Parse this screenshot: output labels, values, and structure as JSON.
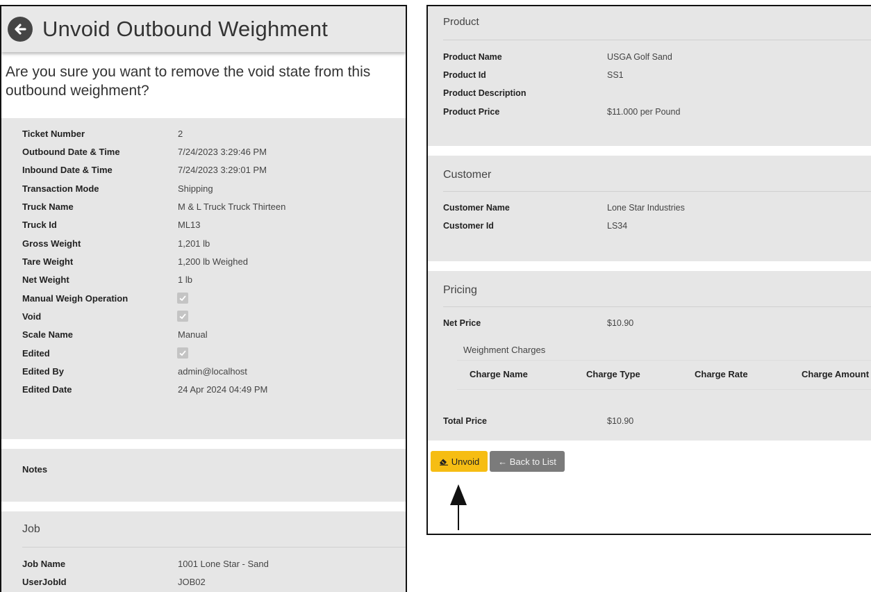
{
  "header": {
    "title": "Unvoid Outbound Weighment"
  },
  "question": "Are you sure you want to remove the void state from this outbound weighment?",
  "details": {
    "ticket_number": {
      "label": "Ticket Number",
      "value": "2"
    },
    "outbound_datetime": {
      "label": "Outbound Date & Time",
      "value": "7/24/2023 3:29:46 PM"
    },
    "inbound_datetime": {
      "label": "Inbound Date & Time",
      "value": "7/24/2023 3:29:01 PM"
    },
    "transaction_mode": {
      "label": "Transaction Mode",
      "value": "Shipping"
    },
    "truck_name": {
      "label": "Truck Name",
      "value": "M & L Truck Truck Thirteen"
    },
    "truck_id": {
      "label": "Truck Id",
      "value": "ML13"
    },
    "gross_weight": {
      "label": "Gross Weight",
      "value": "1,201 lb"
    },
    "tare_weight": {
      "label": "Tare Weight",
      "value": "1,200 lb Weighed"
    },
    "net_weight": {
      "label": "Net Weight",
      "value": "1 lb"
    },
    "manual_weigh": {
      "label": "Manual Weigh Operation",
      "checked": true
    },
    "void": {
      "label": "Void",
      "checked": true
    },
    "scale_name": {
      "label": "Scale Name",
      "value": "Manual"
    },
    "edited": {
      "label": "Edited",
      "checked": true
    },
    "edited_by": {
      "label": "Edited By",
      "value": "admin@localhost"
    },
    "edited_date": {
      "label": "Edited Date",
      "value": "24 Apr 2024 04:49 PM"
    }
  },
  "notes": {
    "label": "Notes"
  },
  "job": {
    "heading": "Job",
    "job_name": {
      "label": "Job Name",
      "value": "1001 Lone Star - Sand"
    },
    "user_job_id": {
      "label": "UserJobId",
      "value": "JOB02"
    }
  },
  "product": {
    "heading": "Product",
    "name": {
      "label": "Product Name",
      "value": "USGA Golf Sand"
    },
    "id": {
      "label": "Product Id",
      "value": "SS1"
    },
    "description": {
      "label": "Product Description",
      "value": ""
    },
    "price": {
      "label": "Product Price",
      "value": "$11.000 per Pound"
    }
  },
  "customer": {
    "heading": "Customer",
    "name": {
      "label": "Customer Name",
      "value": "Lone Star Industries"
    },
    "id": {
      "label": "Customer Id",
      "value": "LS34"
    }
  },
  "pricing": {
    "heading": "Pricing",
    "net_price": {
      "label": "Net Price",
      "value": "$10.90"
    },
    "charges_title": "Weighment Charges",
    "charge_columns": [
      "Charge Name",
      "Charge Type",
      "Charge Rate",
      "Charge Amount"
    ],
    "total_price": {
      "label": "Total Price",
      "value": "$10.90"
    }
  },
  "actions": {
    "unvoid_label": "Unvoid",
    "back_label": "← Back to List"
  },
  "colors": {
    "unvoid_button": "#f6bd13",
    "back_button": "#7b7b7b",
    "section_bg": "#e6e6e6",
    "header_bg": "#e8e8e8"
  }
}
